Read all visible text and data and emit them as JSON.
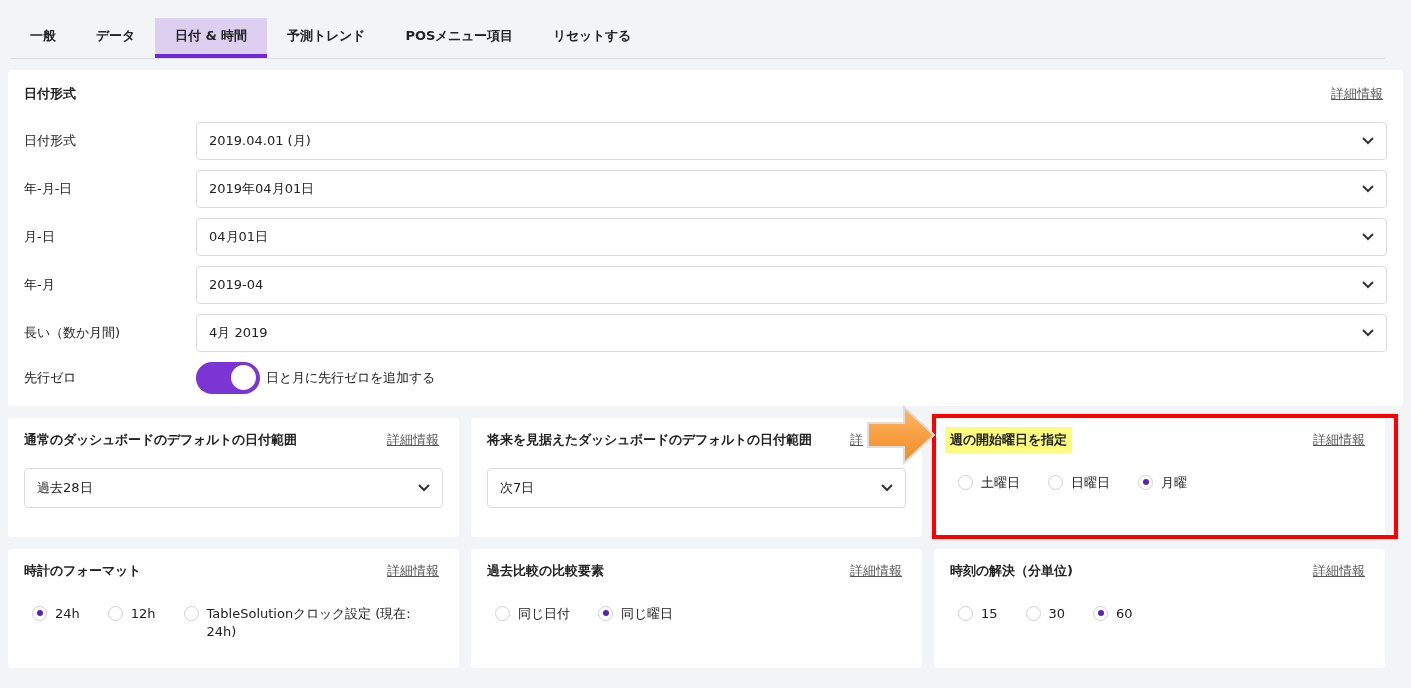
{
  "tabs": [
    {
      "label": "一般",
      "selected": false
    },
    {
      "label": "データ",
      "selected": false
    },
    {
      "label": "日付 & 時間",
      "selected": true
    },
    {
      "label": "予測トレンド",
      "selected": false
    },
    {
      "label": "POSメニュー項目",
      "selected": false
    },
    {
      "label": "リセットする",
      "selected": false
    }
  ],
  "date_format": {
    "title": "日付形式",
    "info_link": "詳細情報",
    "rows": [
      {
        "kind": "select",
        "label": "日付形式",
        "value": "2019.04.01 (月)"
      },
      {
        "kind": "select",
        "label": "年-月-日",
        "value": "2019年04月01日"
      },
      {
        "kind": "select",
        "label": "月-日",
        "value": "04月01日"
      },
      {
        "kind": "select",
        "label": "年-月",
        "value": "2019-04"
      },
      {
        "kind": "select",
        "label": "長い（数か月間)",
        "value": "4月 2019"
      },
      {
        "kind": "toggle",
        "label": "先行ゼロ",
        "on": true,
        "text": "日と月に先行ゼロを追加する"
      }
    ]
  },
  "cards": [
    {
      "kind": "select",
      "title": "通常のダッシュボードのデフォルトの日付範囲",
      "info_link": "詳細情報",
      "value": "過去28日"
    },
    {
      "kind": "select",
      "title": "将来を見据えたダッシュボードのデフォルトの日付範囲",
      "info_link": "詳",
      "value": "次7日"
    },
    {
      "kind": "radio",
      "title": "週の開始曜日を指定",
      "highlighted": true,
      "info_link": "詳細情報",
      "options": [
        {
          "label": "土曜日",
          "selected": false
        },
        {
          "label": "日曜日",
          "selected": false
        },
        {
          "label": "月曜",
          "selected": true
        }
      ]
    },
    {
      "kind": "radio",
      "title": "時計のフォーマット",
      "info_link": "詳細情報",
      "options": [
        {
          "label": "24h",
          "selected": true
        },
        {
          "label": "12h",
          "selected": false
        },
        {
          "label": "TableSolutionクロック設定 (現在: 24h)",
          "selected": false
        }
      ]
    },
    {
      "kind": "radio",
      "title": "過去比較の比較要素",
      "info_link": "詳細情報",
      "options": [
        {
          "label": "同じ日付",
          "selected": false
        },
        {
          "label": "同じ曜日",
          "selected": true
        }
      ]
    },
    {
      "kind": "radio",
      "title": "時刻の解決（分単位)",
      "info_link": "詳細情報",
      "options": [
        {
          "label": "15",
          "selected": false
        },
        {
          "label": "30",
          "selected": false
        },
        {
          "label": "60",
          "selected": true
        }
      ]
    }
  ]
}
